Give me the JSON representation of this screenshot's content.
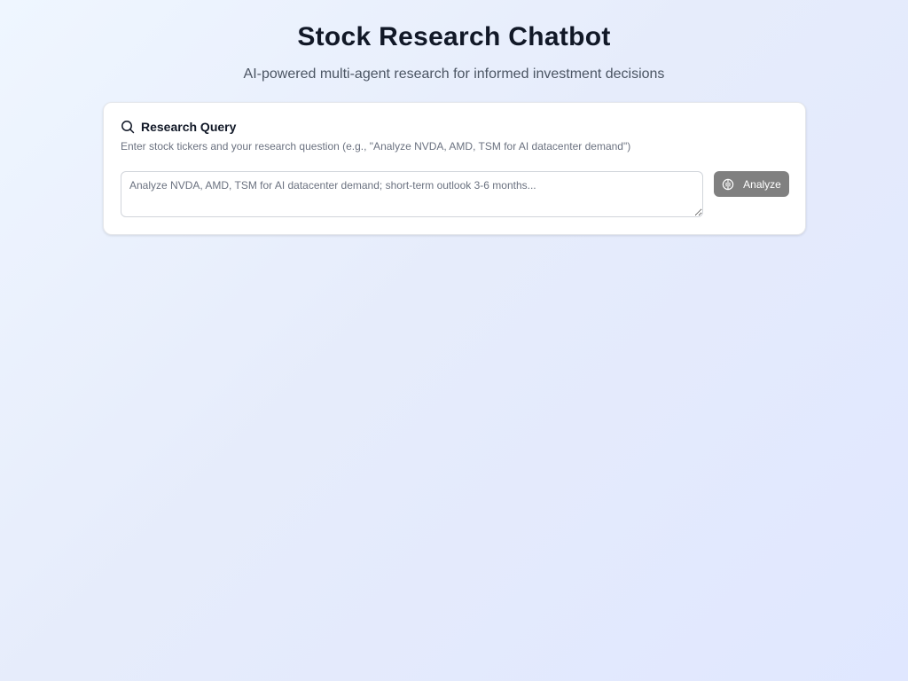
{
  "header": {
    "title": "Stock Research Chatbot",
    "subtitle": "AI-powered multi-agent research for informed investment decisions"
  },
  "query_card": {
    "title": "Research Query",
    "icon": "search-icon",
    "description": "Enter stock tickers and your research question (e.g., \"Analyze NVDA, AMD, TSM for AI datacenter demand\")",
    "input": {
      "value": "",
      "placeholder": "Analyze NVDA, AMD, TSM for AI datacenter demand; short-term outlook 3-6 months..."
    },
    "analyze_button": {
      "label": "Analyze",
      "icon": "brain-icon",
      "background": "#808080"
    }
  },
  "colors": {
    "background_start": "#eff6ff",
    "background_end": "#e0e7ff",
    "title": "#111827",
    "subtitle": "#4b5563"
  }
}
